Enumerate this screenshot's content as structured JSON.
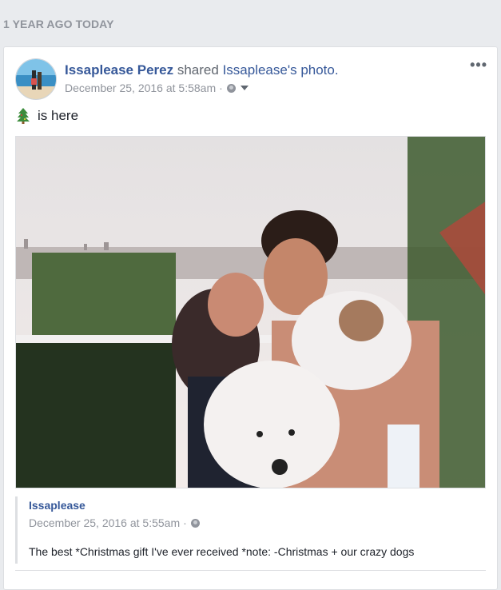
{
  "memory": {
    "header": "1 YEAR AGO TODAY"
  },
  "post": {
    "author": "Issaplease Perez",
    "action_text": "shared",
    "original_owner": "Issaplease",
    "object_text": "'s photo.",
    "timestamp": "December 25, 2016 at 5:58am",
    "separator": "·",
    "privacy_icon": "globe-icon",
    "audience_menu_icon": "chevron-down-icon",
    "more_options": "•••",
    "status_emoji": "christmas-tree-icon",
    "status_text": "is here"
  },
  "shared_post": {
    "author": "Issaplease",
    "timestamp": "December 25, 2016 at 5:55am",
    "separator": "·",
    "caption": "The best *Christmas gift I've ever received *note: -Christmas + our crazy dogs"
  },
  "colors": {
    "link": "#365899",
    "meta": "#90949c",
    "background": "#e9ebee",
    "card": "#ffffff"
  }
}
